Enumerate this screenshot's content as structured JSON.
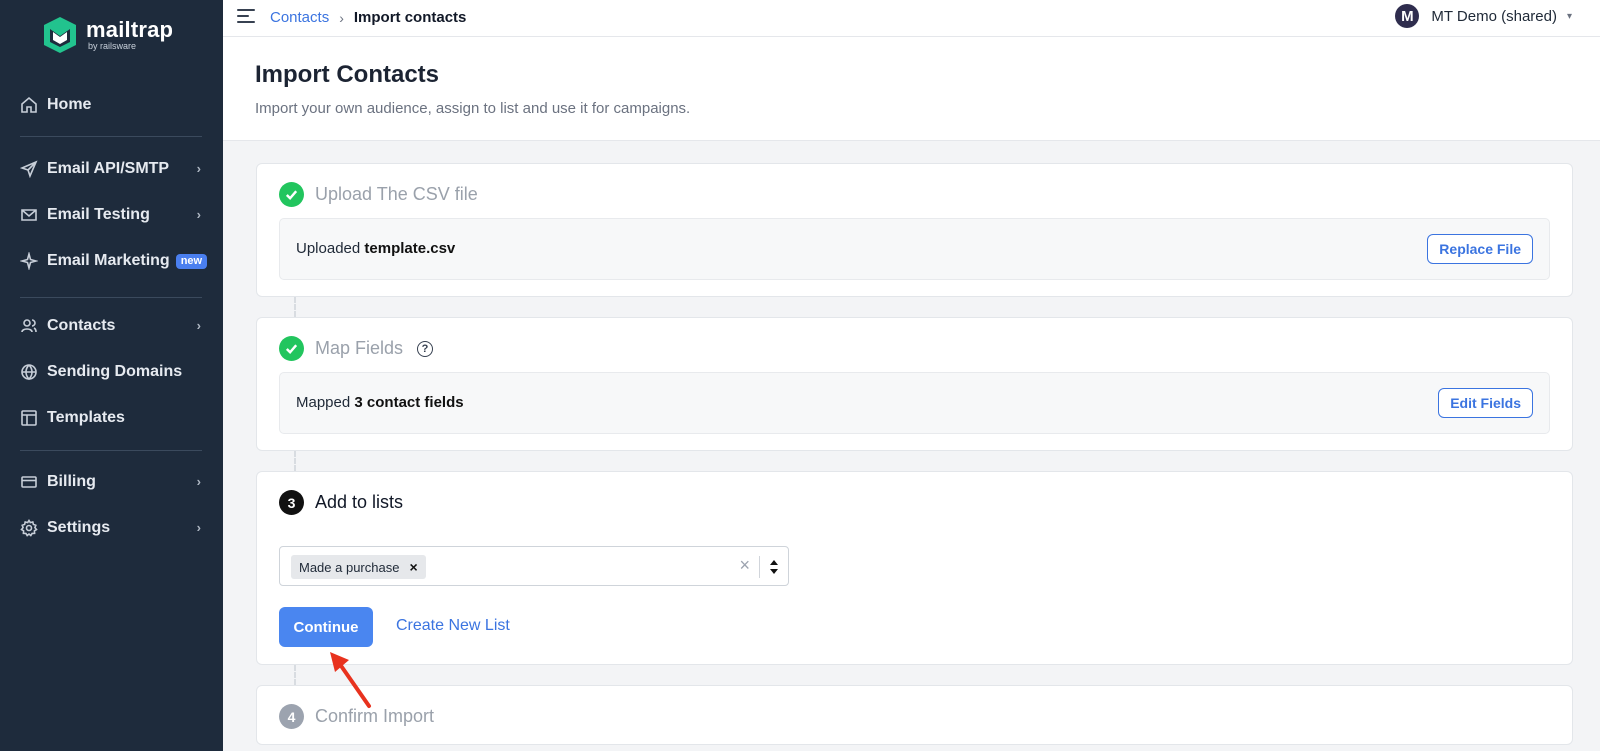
{
  "brand": {
    "name": "mailtrap",
    "sub": "by railsware"
  },
  "sidebar": {
    "items": [
      {
        "label": "Home",
        "icon": "home-icon"
      },
      {
        "label": "Email API/SMTP",
        "icon": "send-icon"
      },
      {
        "label": "Email Testing",
        "icon": "mail-check-icon"
      },
      {
        "label": "Email Marketing",
        "icon": "sparkle-icon",
        "badge": "new"
      },
      {
        "label": "Contacts",
        "icon": "users-icon"
      },
      {
        "label": "Sending Domains",
        "icon": "globe-icon"
      },
      {
        "label": "Templates",
        "icon": "layout-icon"
      },
      {
        "label": "Billing",
        "icon": "card-icon"
      },
      {
        "label": "Settings",
        "icon": "gear-icon"
      }
    ]
  },
  "topbar": {
    "breadcrumb_link": "Contacts",
    "breadcrumb_sep": "›",
    "breadcrumb_current": "Import contacts",
    "avatar_letter": "M",
    "account_name": "MT Demo (shared)"
  },
  "header": {
    "title": "Import Contacts",
    "subtitle": "Import your own audience, assign to list and use it for campaigns."
  },
  "steps": {
    "upload": {
      "title": "Upload The CSV file",
      "status_prefix": "Uploaded",
      "file_name": "template.csv",
      "button": "Replace File"
    },
    "map": {
      "title": "Map Fields",
      "help": "?",
      "status_prefix": "Mapped",
      "fields_text": "3 contact fields",
      "button": "Edit Fields"
    },
    "lists": {
      "number": "3",
      "title": "Add to lists",
      "selected_chip": "Made a purchase",
      "chip_remove": "×",
      "clear": "×",
      "continue_label": "Continue",
      "create_label": "Create New List"
    },
    "confirm": {
      "number": "4",
      "title": "Confirm Import"
    }
  },
  "colors": {
    "sidebar_bg": "#1e2b3c",
    "accent": "#3b74e0",
    "primary_button": "#4a86f0",
    "success": "#22c55e",
    "annotation_arrow": "#e8321e"
  }
}
